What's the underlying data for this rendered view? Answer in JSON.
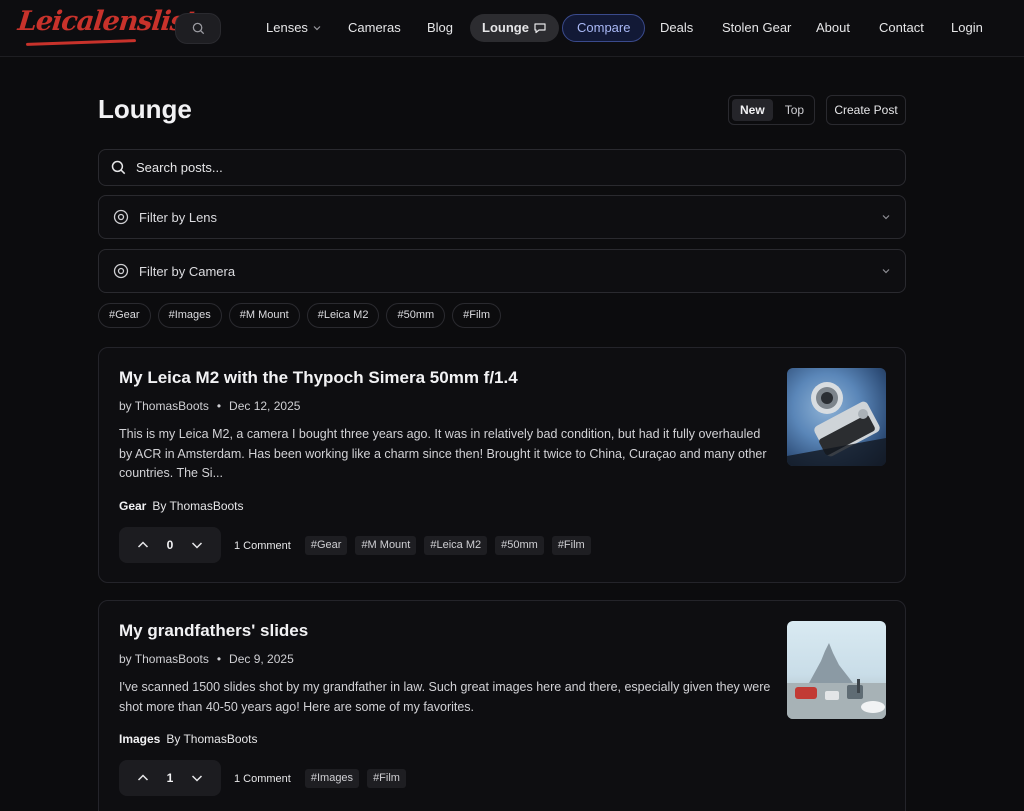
{
  "brand": {
    "logo": "Leicalenslist"
  },
  "nav": {
    "items": [
      {
        "label": "Lenses",
        "has_dropdown": true
      },
      {
        "label": "Cameras"
      },
      {
        "label": "Blog"
      },
      {
        "label": "Lounge",
        "active": true
      },
      {
        "label": "Compare",
        "highlight": true
      },
      {
        "label": "Deals"
      },
      {
        "label": "Stolen Gear"
      },
      {
        "label": "About"
      },
      {
        "label": "Contact"
      },
      {
        "label": "Login"
      }
    ]
  },
  "page": {
    "title": "Lounge",
    "sort": {
      "options": [
        "New",
        "Top"
      ],
      "selected": "New"
    },
    "create_label": "Create Post",
    "search": {
      "placeholder": "Search posts..."
    },
    "filters": [
      {
        "label": "Filter by Lens"
      },
      {
        "label": "Filter by Camera"
      }
    ],
    "tags": [
      "#Gear",
      "#Images",
      "#M Mount",
      "#Leica M2",
      "#50mm",
      "#Film"
    ]
  },
  "posts": [
    {
      "title": "My Leica M2 with the Thypoch Simera 50mm f/1.4",
      "author_line": "by ThomasBoots",
      "separator": "•",
      "date": "Dec 12, 2025",
      "excerpt": "This is my Leica M2, a camera I bought three years ago. It was in relatively bad condition, but had it fully overhauled by ACR in Amsterdam. Has been working like a charm since then! Brought it twice to China, Curaçao and many other countries. The Si...",
      "category": "Gear",
      "by": "By ThomasBoots",
      "votes": "0",
      "comments": "1 Comment",
      "tags": [
        "#Gear",
        "#M Mount",
        "#Leica M2",
        "#50mm",
        "#Film"
      ]
    },
    {
      "title": "My grandfathers' slides",
      "author_line": "by ThomasBoots",
      "separator": "•",
      "date": "Dec 9, 2025",
      "excerpt": "I've scanned 1500 slides shot by my grandfather in law. Such great images here and there, especially given they were shot more than 40-50 years ago! Here are some of my favorites.",
      "category": "Images",
      "by": "By ThomasBoots",
      "votes": "1",
      "comments": "1 Comment",
      "tags": [
        "#Images",
        "#Film"
      ]
    }
  ],
  "icons": {
    "search": "search-icon",
    "chevron_down": "chevron-down-icon",
    "chat": "chat-bubble-icon",
    "lens_target": "target-icon",
    "up": "arrow-up-icon",
    "down": "arrow-down-icon"
  },
  "colors": {
    "brand": "#c8322b",
    "compare_accent": "#a9b8f5",
    "background": "#0c0c0e"
  }
}
